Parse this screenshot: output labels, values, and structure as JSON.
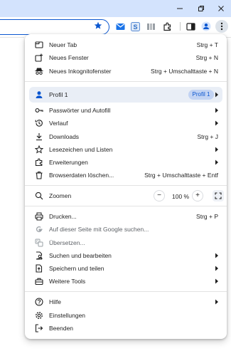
{
  "window": {
    "minimize_icon": "minimize-icon",
    "restore_icon": "restore-icon",
    "close_icon": "close-icon"
  },
  "toolbar": {
    "omnibox_value": "",
    "icons": [
      "bookmark-star-icon",
      "mail-extension-icon",
      "s-extension-icon",
      "book-extension-icon",
      "puzzle-extension-icon",
      "side-panel-icon",
      "profile-icon",
      "kebab-menu-icon"
    ]
  },
  "menu": {
    "new_tab": {
      "label": "Neuer Tab",
      "shortcut": "Strg + T"
    },
    "new_window": {
      "label": "Neues Fenster",
      "shortcut": "Strg + N"
    },
    "incognito": {
      "label": "Neues Inkognitofenster",
      "shortcut": "Strg + Umschalttaste + N"
    },
    "profile": {
      "label": "Profil 1",
      "chip": "Profil 1"
    },
    "passwords": {
      "label": "Passwörter und Autofill"
    },
    "history": {
      "label": "Verlauf"
    },
    "downloads": {
      "label": "Downloads",
      "shortcut": "Strg + J"
    },
    "bookmarks": {
      "label": "Lesezeichen und Listen"
    },
    "extensions": {
      "label": "Erweiterungen"
    },
    "clear_data": {
      "label": "Browserdaten löschen...",
      "shortcut": "Strg + Umschalttaste + Entf"
    },
    "zoom": {
      "label": "Zoomen",
      "minus": "−",
      "value": "100 %",
      "plus": "+"
    },
    "print": {
      "label": "Drucken...",
      "shortcut": "Strg + P"
    },
    "google_search": {
      "label": "Auf dieser Seite mit Google suchen..."
    },
    "translate": {
      "label": "Übersetzen..."
    },
    "find_edit": {
      "label": "Suchen und bearbeiten"
    },
    "save_share": {
      "label": "Speichern und teilen"
    },
    "more_tools": {
      "label": "Weitere Tools"
    },
    "help": {
      "label": "Hilfe"
    },
    "settings": {
      "label": "Einstellungen"
    },
    "exit": {
      "label": "Beenden"
    }
  },
  "colors": {
    "accent": "#0b57d0",
    "titlebar": "#d3e3fd",
    "profile_row": "#e9eef6",
    "chip": "#c2d3f3"
  }
}
